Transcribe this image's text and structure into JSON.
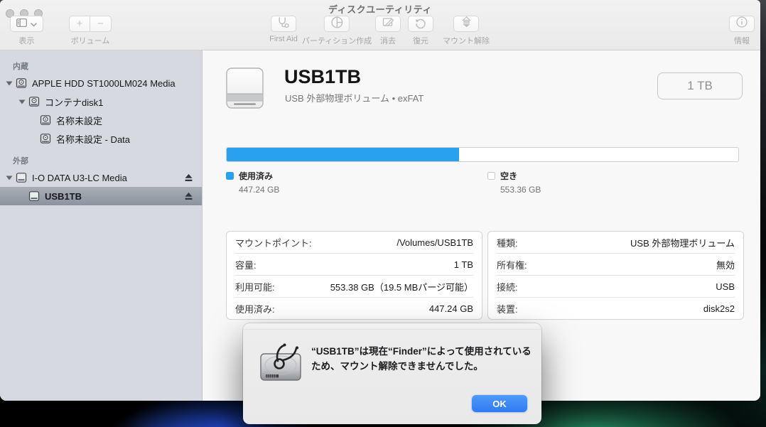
{
  "window": {
    "title": "ディスクユーティリティ",
    "toolbar": {
      "view_label": "表示",
      "volume_label": "ボリューム",
      "volume_plus": "+",
      "volume_minus": "−",
      "first_aid_label": "First Aid",
      "partition_label": "パーティション作成",
      "erase_label": "消去",
      "restore_label": "復元",
      "unmount_label": "マウント解除",
      "info_label": "情報"
    }
  },
  "sidebar": {
    "sections": [
      {
        "label": "内蔵",
        "items": [
          {
            "label": "APPLE HDD ST1000LM024 Media",
            "level": 0,
            "disclosure": true,
            "icon": "internal",
            "eject": false,
            "selected": false
          },
          {
            "label": "コンテナdisk1",
            "level": 1,
            "disclosure": true,
            "icon": "internal",
            "eject": false,
            "selected": false
          },
          {
            "label": "名称未設定",
            "level": 2,
            "disclosure": false,
            "icon": "internal",
            "eject": false,
            "selected": false
          },
          {
            "label": "名称未設定 - Data",
            "level": 2,
            "disclosure": false,
            "icon": "internal",
            "eject": false,
            "selected": false
          }
        ]
      },
      {
        "label": "外部",
        "items": [
          {
            "label": "I-O DATA U3-LC Media",
            "level": 0,
            "disclosure": true,
            "icon": "external",
            "eject": true,
            "selected": false
          },
          {
            "label": "USB1TB",
            "level": 1,
            "disclosure": false,
            "icon": "external",
            "eject": true,
            "selected": true
          }
        ]
      }
    ]
  },
  "main": {
    "volume_title": "USB1TB",
    "volume_subtitle": "USB 外部物理ボリューム • exFAT",
    "capacity_button_label": "1 TB",
    "usage": {
      "used_label": "使用済み",
      "used_value": "447.24 GB",
      "free_label": "空き",
      "free_value": "553.36 GB",
      "used_percent": 45.4,
      "used_color": "#2AA1EE",
      "free_color": "#FFFFFF"
    },
    "details_left": [
      {
        "label": "マウントポイント:",
        "value": "/Volumes/USB1TB"
      },
      {
        "label": "容量:",
        "value": "1 TB"
      },
      {
        "label": "利用可能:",
        "value": "553.38 GB（19.5 MBパージ可能）"
      },
      {
        "label": "使用済み:",
        "value": "447.24 GB"
      }
    ],
    "details_right": [
      {
        "label": "種類:",
        "value": "USB 外部物理ボリューム"
      },
      {
        "label": "所有権:",
        "value": "無効"
      },
      {
        "label": "接続:",
        "value": "USB"
      },
      {
        "label": "装置:",
        "value": "disk2s2"
      }
    ]
  },
  "dialog": {
    "message": "“USB1TB”は現在“Finder”によって使用されているため、マウント解除できませんでした。",
    "ok_label": "OK"
  }
}
